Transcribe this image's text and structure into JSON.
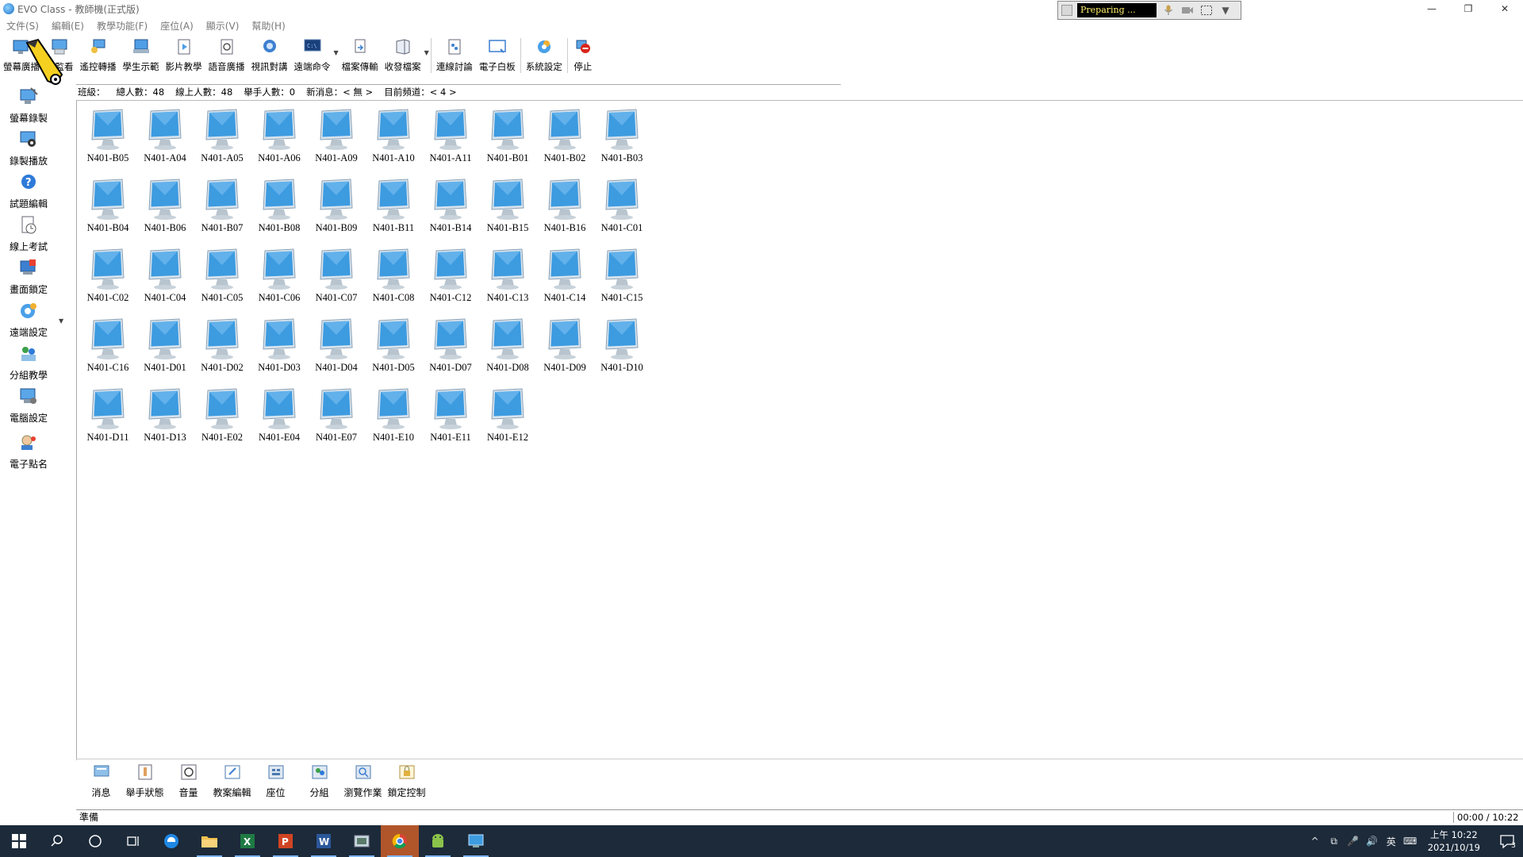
{
  "window": {
    "title": "EVO Class - 教師機(正式版)",
    "controls": [
      "—",
      "❐",
      "✕"
    ]
  },
  "recorder": {
    "status": "Preparing ...",
    "dropdown": "▼"
  },
  "menu": [
    "文件(S)",
    "編輯(E)",
    "教學功能(F)",
    "座位(A)",
    "顯示(V)",
    "幫助(H)"
  ],
  "toolbar": {
    "buttons": [
      {
        "label": "螢幕廣播",
        "icon": "screen-broadcast-icon"
      },
      {
        "label": "控監看",
        "icon": "monitor-icon"
      },
      {
        "label": "遙控轉播",
        "icon": "remote-relay-icon"
      },
      {
        "label": "學生示範",
        "icon": "student-demo-icon"
      },
      {
        "label": "影片教學",
        "icon": "video-teach-icon"
      },
      {
        "label": "語音廣播",
        "icon": "voice-broadcast-icon"
      },
      {
        "label": "視訊對講",
        "icon": "video-intercom-icon"
      },
      {
        "label": "遠端命令",
        "icon": "remote-command-icon"
      },
      {
        "label": "檔案傳輸",
        "icon": "file-transfer-icon"
      },
      {
        "label": "收發檔案",
        "icon": "collect-files-icon"
      },
      {
        "label": "連線討論",
        "icon": "discussion-icon"
      },
      {
        "label": "電子白板",
        "icon": "whiteboard-icon"
      },
      {
        "label": "系統設定",
        "icon": "system-settings-icon"
      },
      {
        "label": "停止",
        "icon": "stop-icon"
      }
    ]
  },
  "info": {
    "class": "班級：",
    "total": "總人數：48",
    "online": "線上人數：48",
    "raised": "舉手人數：0",
    "news": "新消息：< 無 >",
    "channel": "目前頻道：< 4 >"
  },
  "sidebar": [
    {
      "label": "螢幕錄製",
      "icon": "screen-record-icon"
    },
    {
      "label": "錄製播放",
      "icon": "record-playback-icon"
    },
    {
      "label": "試題編輯",
      "icon": "exam-edit-icon"
    },
    {
      "label": "線上考試",
      "icon": "online-exam-icon"
    },
    {
      "label": "畫面鎖定",
      "icon": "screen-lock-icon"
    },
    {
      "label": "遠端設定",
      "icon": "remote-settings-icon"
    },
    {
      "label": "分組教學",
      "icon": "group-teach-icon"
    },
    {
      "label": "電腦設定",
      "icon": "computer-settings-icon"
    },
    {
      "label": "電子點名",
      "icon": "roll-call-icon"
    }
  ],
  "computers": [
    "N401-B05",
    "N401-A04",
    "N401-A05",
    "N401-A06",
    "N401-A09",
    "N401-A10",
    "N401-A11",
    "N401-B01",
    "N401-B02",
    "N401-B03",
    "N401-B04",
    "N401-B06",
    "N401-B07",
    "N401-B08",
    "N401-B09",
    "N401-B11",
    "N401-B14",
    "N401-B15",
    "N401-B16",
    "N401-C01",
    "N401-C02",
    "N401-C04",
    "N401-C05",
    "N401-C06",
    "N401-C07",
    "N401-C08",
    "N401-C12",
    "N401-C13",
    "N401-C14",
    "N401-C15",
    "N401-C16",
    "N401-D01",
    "N401-D02",
    "N401-D03",
    "N401-D04",
    "N401-D05",
    "N401-D07",
    "N401-D08",
    "N401-D09",
    "N401-D10",
    "N401-D11",
    "N401-D13",
    "N401-E02",
    "N401-E04",
    "N401-E07",
    "N401-E10",
    "N401-E11",
    "N401-E12"
  ],
  "bottom_toolbar": [
    {
      "label": "消息",
      "icon": "message-icon"
    },
    {
      "label": "舉手狀態",
      "icon": "raise-hand-icon"
    },
    {
      "label": "音量",
      "icon": "volume-icon"
    },
    {
      "label": "教案編輯",
      "icon": "lesson-edit-icon"
    },
    {
      "label": "座位",
      "icon": "seat-icon"
    },
    {
      "label": "分組",
      "icon": "group-icon"
    },
    {
      "label": "瀏覽作業",
      "icon": "browse-homework-icon"
    },
    {
      "label": "鎖定控制",
      "icon": "lock-control-icon"
    }
  ],
  "status": {
    "left": "準備",
    "time": "00:00 / 10:22"
  },
  "taskbar": {
    "apps": [
      {
        "name": "start-icon"
      },
      {
        "name": "search-icon"
      },
      {
        "name": "cortana-icon"
      },
      {
        "name": "task-view-icon"
      },
      {
        "name": "edge-icon"
      },
      {
        "name": "file-explorer-icon"
      },
      {
        "name": "excel-icon"
      },
      {
        "name": "powerpoint-icon"
      },
      {
        "name": "word-icon"
      },
      {
        "name": "app-icon"
      },
      {
        "name": "chrome-icon"
      },
      {
        "name": "android-icon"
      },
      {
        "name": "evo-class-icon"
      }
    ],
    "tray": [
      "^",
      "⧉",
      "🎤",
      "🔊",
      "英",
      "⌨"
    ],
    "clock_time": "上午 10:22",
    "clock_date": "2021/10/19",
    "notify_count": "3"
  },
  "colors": {
    "taskbar_bg": "#1c2a3a",
    "monitor_screen": "#3d9be0",
    "stop_red": "#d9251c"
  }
}
